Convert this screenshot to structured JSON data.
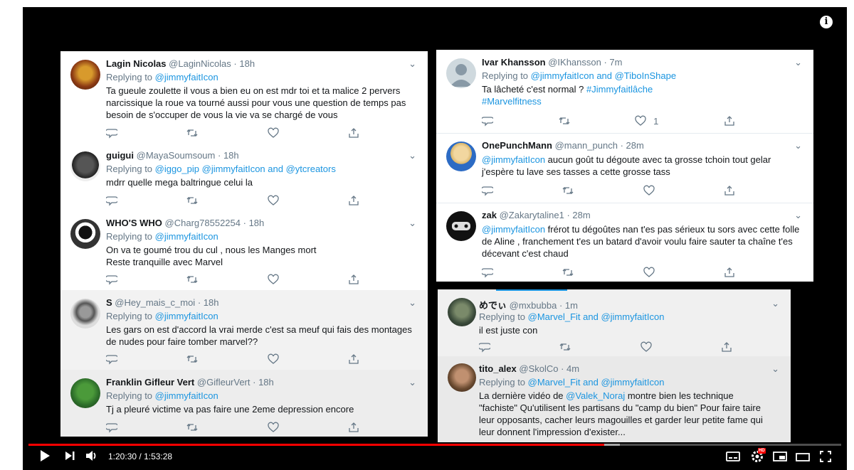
{
  "player": {
    "info_label": "i",
    "time_current": "1:20:30",
    "time_separator": " / ",
    "time_total": "1:53:28",
    "progress_fraction": 0.708,
    "buffered_fraction": 0.728,
    "hd_badge": "HD"
  },
  "left_panel": [
    {
      "name": "Lagin Nicolas",
      "handle": "@LaginNicolas",
      "time": "18h",
      "replying_prefix": "Replying to ",
      "replying_to": "@jimmyfaitIcon",
      "body": "Ta gueule zoulette il vous a bien eu on est mdr toi et ta malice 2 pervers narcissique la roue va tourné aussi pour vous une question de temps pas besoin de s'occuper de vous la vie va se chargé de vous",
      "likes": ""
    },
    {
      "name": "guigui",
      "handle": "@MayaSoumsoum",
      "time": "18h",
      "replying_prefix": "Replying to ",
      "replying_to": "@iggo_pip @jimmyfaitIcon and @ytcreators",
      "body": "mdrr quelle mega baltringue celui la",
      "likes": ""
    },
    {
      "name": "WHO'S WHO",
      "handle": "@Charg78552254",
      "time": "18h",
      "replying_prefix": "Replying to ",
      "replying_to": "@jimmyfaitIcon",
      "body": "On va te goumé trou du cul , nous les Manges mort\nReste tranquille avec Marvel",
      "likes": ""
    },
    {
      "name": "S",
      "handle": "@Hey_mais_c_moi",
      "time": "18h",
      "replying_prefix": "Replying to ",
      "replying_to": "@jimmyfaitIcon",
      "body": "Les gars on est d'accord la vrai merde c'est sa meuf qui fais des montages de nudes pour faire tomber marvel??",
      "likes": ""
    },
    {
      "name": "Franklin Gifleur Vert",
      "handle": "@GifleurVert",
      "time": "18h",
      "replying_prefix": "Replying to ",
      "replying_to": "@jimmyfaitIcon",
      "body": "Tj a pleuré victime va pas faire une 2eme depression encore",
      "likes": ""
    }
  ],
  "right_panel": [
    {
      "name": "Ivar Khansson",
      "handle": "@IKhansson",
      "time": "7m",
      "replying_prefix": "Replying to ",
      "replying_to": "@jimmyfaitIcon and @TiboInShape",
      "body": "Ta lâcheté c'est normal ? ",
      "body_tags": "#Jimmyfaitlâche #Marvelfitness",
      "likes": "1"
    },
    {
      "name": "OnePunchMann",
      "handle": "@mann_punch",
      "time": "28m",
      "mention": "@jimmyfaitIcon",
      "body": " aucun goût tu dégoute avec ta grosse tchoin tout gelar j'espère tu lave ses tasses a cette grosse tass",
      "likes": ""
    },
    {
      "name": "zak",
      "handle": "@Zakarytaline1",
      "time": "28m",
      "mention": "@jimmyfaitIcon",
      "body": " frérot tu dégoûtes nan t'es pas sérieux tu sors avec cette folle de Aline , franchement t'es un batard d'avoir voulu faire sauter ta chaîne t'es décevant c'est chaud",
      "likes": ""
    }
  ],
  "right_panel2": [
    {
      "name": "めでぃ",
      "handle": "@mxbubba",
      "time": "1m",
      "replying_prefix": "Replying to ",
      "replying_to": "@Marvel_Fit and @jimmyfaitIcon",
      "body": "il est juste con",
      "likes": ""
    },
    {
      "name": "tito_alex",
      "handle": "@SkolCo",
      "time": "4m",
      "replying_prefix": "Replying to ",
      "replying_to": "@Marvel_Fit and @jimmyfaitIcon",
      "body_prefix": "La dernière vidéo de ",
      "mention": "@Valek_Noraj",
      "body": " montre bien les technique \"fachiste\" Qu'utilisent les partisans du \"camp du bien\" Pour faire taire leur opposants, cacher leurs magouilles et garder leur petite fame qui leur donnent l'impression d'exister...",
      "likes": ""
    }
  ],
  "colors": {
    "link": "#1b95e0",
    "progress": "#ff0000"
  },
  "icons": [
    "reply-icon",
    "retweet-icon",
    "like-icon",
    "share-icon",
    "chevron-down-icon",
    "play-icon",
    "next-icon",
    "volume-icon",
    "subtitles-icon",
    "settings-icon",
    "miniplayer-icon",
    "theater-icon",
    "fullscreen-icon",
    "info-icon"
  ]
}
